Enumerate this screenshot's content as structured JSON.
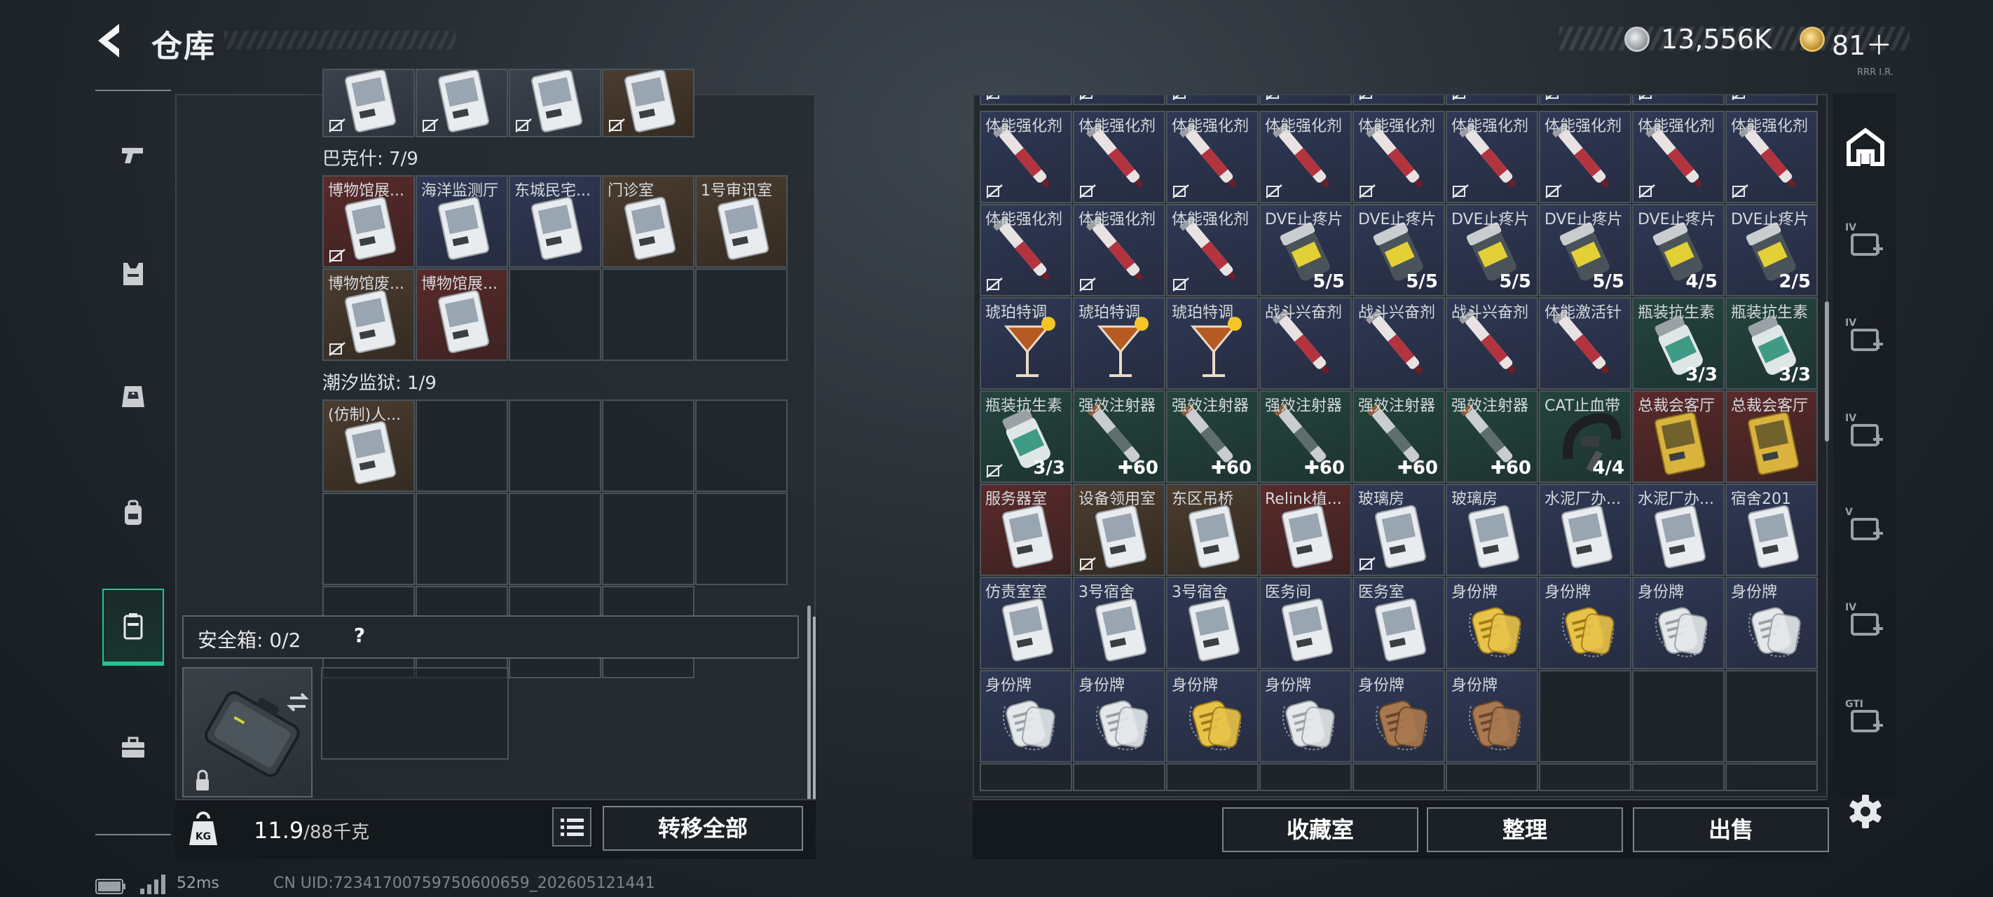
{
  "header": {
    "title": "仓库",
    "silver_amount": "13,556K",
    "gold_amount": "81＋",
    "version": "RRR I.R."
  },
  "nav": [
    {
      "icon": "pistol-icon"
    },
    {
      "icon": "armor-vest-icon"
    },
    {
      "icon": "chest-rig-icon"
    },
    {
      "icon": "backpack-icon"
    },
    {
      "icon": "safe-case-icon",
      "active": true
    },
    {
      "icon": "toolbox-icon"
    }
  ],
  "left": {
    "groups": [
      {
        "title": "巴克什: 7/9"
      },
      {
        "title": "潮汐监狱: 1/9"
      }
    ],
    "items": [
      {
        "label": "博物馆展...",
        "color": "red"
      },
      {
        "label": "海洋监测厅",
        "color": "navy"
      },
      {
        "label": "东城民宅...",
        "color": "navy"
      },
      {
        "label": "门诊室",
        "color": "brown"
      },
      {
        "label": "1号审讯室",
        "color": "brown"
      },
      {
        "label": "博物馆废...",
        "color": "brown"
      },
      {
        "label": "博物馆展...",
        "color": "red"
      },
      {
        "label": "(仿制)人...",
        "color": "brown"
      }
    ],
    "safe_box": {
      "label": "安全箱: 0/2",
      "help": "?"
    },
    "weight": {
      "value": "11.9",
      "unit": "/88千克"
    },
    "transfer_all": "转移全部"
  },
  "right": {
    "items": [
      {
        "label": "体能强化剂",
        "type": "syringe-red",
        "color": "navy",
        "nt": true
      },
      {
        "label": "体能强化剂",
        "type": "syringe-red",
        "color": "navy",
        "nt": true
      },
      {
        "label": "体能强化剂",
        "type": "syringe-red",
        "color": "navy",
        "nt": true
      },
      {
        "label": "体能强化剂",
        "type": "syringe-red",
        "color": "navy",
        "nt": true
      },
      {
        "label": "体能强化剂",
        "type": "syringe-red",
        "color": "navy",
        "nt": true
      },
      {
        "label": "体能强化剂",
        "type": "syringe-red",
        "color": "navy",
        "nt": true
      },
      {
        "label": "体能强化剂",
        "type": "syringe-red",
        "color": "navy",
        "nt": true
      },
      {
        "label": "体能强化剂",
        "type": "syringe-red",
        "color": "navy",
        "nt": true
      },
      {
        "label": "体能强化剂",
        "type": "syringe-red",
        "color": "navy",
        "nt": true
      },
      {
        "label": "体能强化剂",
        "type": "syringe-red",
        "color": "navy",
        "nt": true
      },
      {
        "label": "体能强化剂",
        "type": "syringe-red",
        "color": "navy",
        "nt": true
      },
      {
        "label": "体能强化剂",
        "type": "syringe-red",
        "color": "navy",
        "nt": true
      },
      {
        "label": "DVE止疼片",
        "type": "pill-bottle",
        "color": "navy",
        "count": "5/5"
      },
      {
        "label": "DVE止疼片",
        "type": "pill-bottle",
        "color": "navy",
        "count": "5/5"
      },
      {
        "label": "DVE止疼片",
        "type": "pill-bottle",
        "color": "navy",
        "count": "5/5"
      },
      {
        "label": "DVE止疼片",
        "type": "pill-bottle",
        "color": "navy",
        "count": "5/5"
      },
      {
        "label": "DVE止疼片",
        "type": "pill-bottle",
        "color": "navy",
        "count": "4/5"
      },
      {
        "label": "DVE止疼片",
        "type": "pill-bottle",
        "color": "navy",
        "count": "2/5"
      },
      {
        "label": "琥珀特调",
        "type": "cocktail",
        "color": "navy"
      },
      {
        "label": "琥珀特调",
        "type": "cocktail",
        "color": "navy"
      },
      {
        "label": "琥珀特调",
        "type": "cocktail",
        "color": "navy"
      },
      {
        "label": "战斗兴奋剂",
        "type": "syringe-red",
        "color": "navy"
      },
      {
        "label": "战斗兴奋剂",
        "type": "syringe-red",
        "color": "navy"
      },
      {
        "label": "战斗兴奋剂",
        "type": "syringe-red",
        "color": "navy"
      },
      {
        "label": "体能激活针",
        "type": "syringe-red",
        "color": "navy"
      },
      {
        "label": "瓶装抗生素",
        "type": "bottle-green",
        "color": "teal",
        "count": "3/3"
      },
      {
        "label": "瓶装抗生素",
        "type": "bottle-green",
        "color": "teal",
        "count": "3/3"
      },
      {
        "label": "瓶装抗生素",
        "type": "bottle-green",
        "color": "teal",
        "count": "3/3",
        "nt": true
      },
      {
        "label": "强效注射器",
        "type": "syringe-gray",
        "color": "teal",
        "count": "✚60"
      },
      {
        "label": "强效注射器",
        "type": "syringe-gray",
        "color": "teal",
        "count": "✚60"
      },
      {
        "label": "强效注射器",
        "type": "syringe-gray",
        "color": "teal",
        "count": "✚60"
      },
      {
        "label": "强效注射器",
        "type": "syringe-gray",
        "color": "teal",
        "count": "✚60"
      },
      {
        "label": "强效注射器",
        "type": "syringe-gray",
        "color": "teal",
        "count": "✚60"
      },
      {
        "label": "CAT止血带",
        "type": "tourniquet",
        "color": "teal",
        "count": "4/4"
      },
      {
        "label": "总裁会客厅",
        "type": "card-gold",
        "color": "red"
      },
      {
        "label": "总裁会客厅",
        "type": "card-gold",
        "color": "red"
      },
      {
        "label": "服务器室",
        "type": "card",
        "color": "red"
      },
      {
        "label": "设备领用室",
        "type": "card",
        "color": "brown",
        "nt": true
      },
      {
        "label": "东区吊桥",
        "type": "card",
        "color": "brown"
      },
      {
        "label": "Relink植...",
        "type": "card",
        "color": "red"
      },
      {
        "label": "玻璃房",
        "type": "card",
        "color": "navy",
        "nt": true
      },
      {
        "label": "玻璃房",
        "type": "card",
        "color": "navy"
      },
      {
        "label": "水泥厂办...",
        "type": "card",
        "color": "navy"
      },
      {
        "label": "水泥厂办...",
        "type": "card",
        "color": "navy"
      },
      {
        "label": "宿舍201",
        "type": "card",
        "color": "navy"
      },
      {
        "label": "仿责室室",
        "type": "card",
        "color": "navy"
      },
      {
        "label": "3号宿舍",
        "type": "card",
        "color": "navy"
      },
      {
        "label": "3号宿舍",
        "type": "card",
        "color": "navy"
      },
      {
        "label": "医务间",
        "type": "card",
        "color": "navy"
      },
      {
        "label": "医务室",
        "type": "card",
        "color": "navy"
      },
      {
        "label": "身份牌",
        "type": "tag-gold",
        "color": "navy"
      },
      {
        "label": "身份牌",
        "type": "tag-gold",
        "color": "navy"
      },
      {
        "label": "身份牌",
        "type": "tag-silver",
        "color": "navy"
      },
      {
        "label": "身份牌",
        "type": "tag-silver",
        "color": "navy"
      },
      {
        "label": "身份牌",
        "type": "tag-silver",
        "color": "navy"
      },
      {
        "label": "身份牌",
        "type": "tag-silver",
        "color": "navy"
      },
      {
        "label": "身份牌",
        "type": "tag-gold",
        "color": "navy"
      },
      {
        "label": "身份牌",
        "type": "tag-silver",
        "color": "navy"
      },
      {
        "label": "身份牌",
        "type": "tag-bronze",
        "color": "navy"
      },
      {
        "label": "身份牌",
        "type": "tag-bronze",
        "color": "navy"
      }
    ],
    "buttons": {
      "collection": "收藏室",
      "organize": "整理",
      "sell": "出售"
    }
  },
  "right_nav": [
    {
      "icon": "stash-building-icon",
      "active": true
    },
    {
      "icon": "medical-kit-iv-icon",
      "badge": "IV"
    },
    {
      "icon": "card-iv-icon",
      "badge": "IV"
    },
    {
      "icon": "folder-iv-icon",
      "badge": "IV"
    },
    {
      "icon": "camera-v-icon",
      "badge": "V"
    },
    {
      "icon": "medical-kit-iv-2-icon",
      "badge": "IV"
    },
    {
      "icon": "gti-folder-icon",
      "badge": "GTI"
    }
  ],
  "status": {
    "ping": "52ms",
    "uid": "CN UID:72341700759750600659_202605121441"
  }
}
